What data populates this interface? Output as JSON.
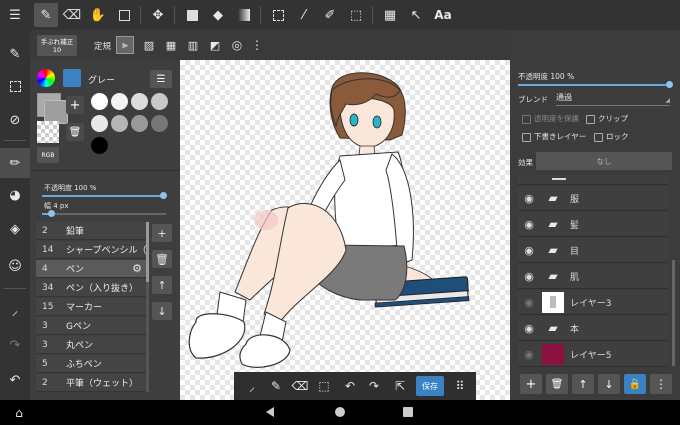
{
  "subbar": {
    "stabilizer_label": "手ぶれ補正",
    "stabilizer_value": "10",
    "ruler_label": "定規"
  },
  "color": {
    "name": "グレー",
    "rgb_label": "RGB",
    "swatches": [
      "#ffffff",
      "#f4f4f4",
      "#dcdcdc",
      "#c8c8c8",
      "#e8e8e8",
      "#b4b4b4",
      "#9a9a9a",
      "#777777",
      "#000000"
    ]
  },
  "brush_panel": {
    "opacity_label": "不透明度 100 %",
    "opacity_pct": 100,
    "width_label": "幅 4 px",
    "brushes": [
      {
        "size": "2",
        "name": "鉛筆"
      },
      {
        "size": "14",
        "name": "シャープペンシル（HB）"
      },
      {
        "size": "4",
        "name": "ペン"
      },
      {
        "size": "34",
        "name": "ペン（入り抜き）"
      },
      {
        "size": "15",
        "name": "マーカー"
      },
      {
        "size": "3",
        "name": "Gペン"
      },
      {
        "size": "3",
        "name": "丸ペン"
      },
      {
        "size": "5",
        "name": "ふちペン"
      },
      {
        "size": "2",
        "name": "平筆（ウェット）"
      }
    ]
  },
  "layer_panel": {
    "opacity_label": "不透明度 100 %",
    "opacity_pct": 100,
    "blend_label": "ブレンド",
    "blend_value": "通過",
    "protect_label": "透明度を保護",
    "clip_label": "クリップ",
    "draft_label": "下書きレイヤー",
    "lock_label": "ロック",
    "effect_label": "効果",
    "effect_value": "なし",
    "layers": [
      {
        "name": "服",
        "type": "folder"
      },
      {
        "name": "髪",
        "type": "folder"
      },
      {
        "name": "目",
        "type": "folder"
      },
      {
        "name": "肌",
        "type": "folder"
      },
      {
        "name": "レイヤー3",
        "type": "image"
      },
      {
        "name": "本",
        "type": "folder"
      },
      {
        "name": "レイヤー5",
        "type": "color"
      }
    ]
  },
  "bottom_toolbar": {
    "save_label": "保存"
  },
  "colors": {
    "accent": "#3b82c4",
    "layer5_fill": "#8b1140"
  }
}
